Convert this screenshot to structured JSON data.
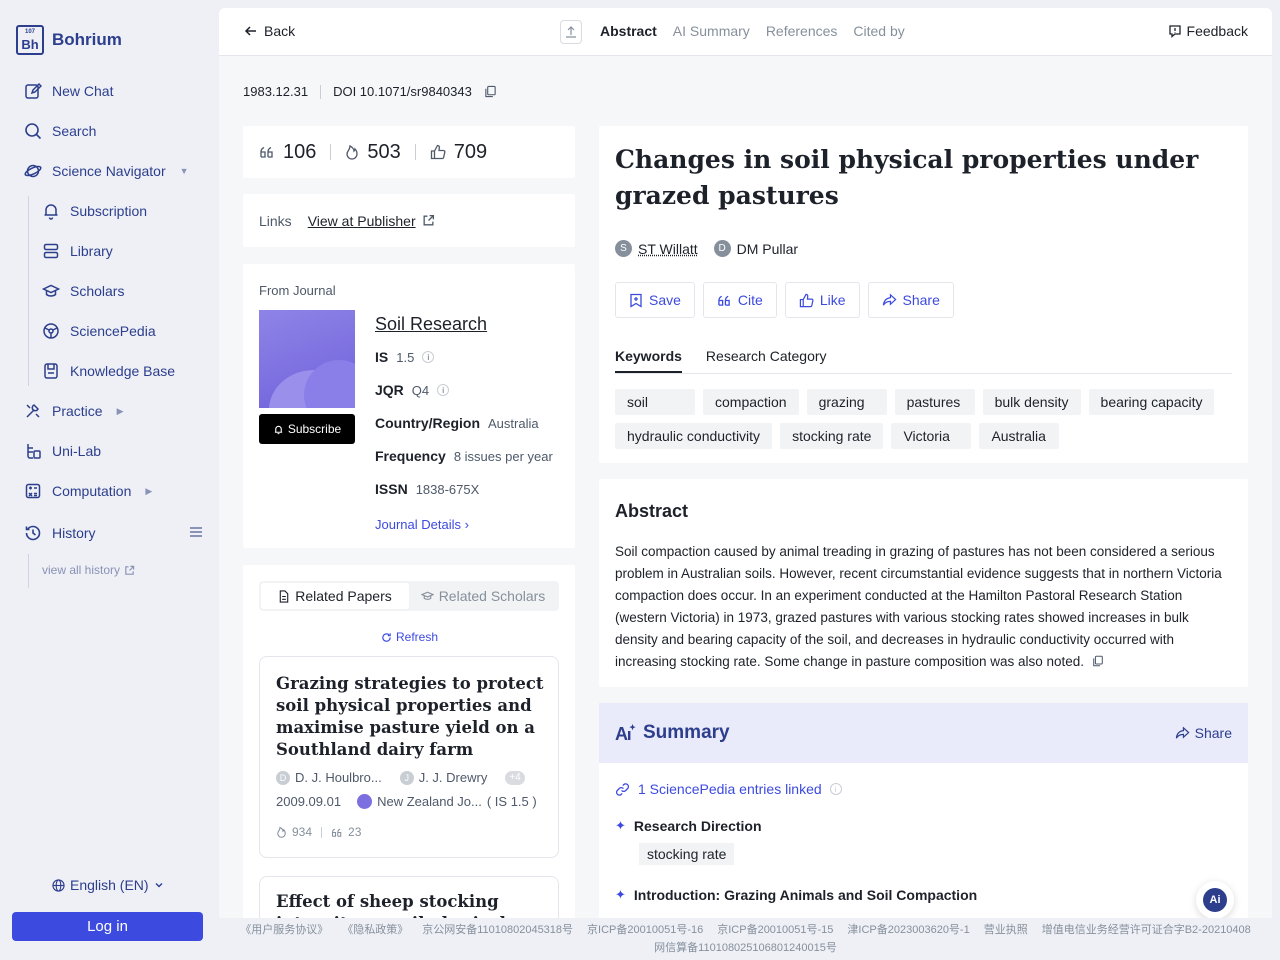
{
  "brand": {
    "name": "Bohrium",
    "logo_text": "Bh",
    "logo_small": "107"
  },
  "sidebar": {
    "items": [
      {
        "label": "New Chat"
      },
      {
        "label": "Search"
      },
      {
        "label": "Science Navigator"
      },
      {
        "label": "Subscription"
      },
      {
        "label": "Library"
      },
      {
        "label": "Scholars"
      },
      {
        "label": "SciencePedia"
      },
      {
        "label": "Knowledge Base"
      },
      {
        "label": "Practice"
      },
      {
        "label": "Uni-Lab"
      },
      {
        "label": "Computation"
      },
      {
        "label": "History"
      }
    ],
    "view_all_history": "view all history",
    "language": "English (EN)",
    "login": "Log in"
  },
  "topbar": {
    "back": "Back",
    "tabs": [
      "Abstract",
      "AI Summary",
      "References",
      "Cited by"
    ],
    "active_tab": "Abstract",
    "feedback": "Feedback"
  },
  "meta": {
    "date": "1983.12.31",
    "doi": "DOI 10.1071/sr9840343"
  },
  "stats": {
    "cites": "106",
    "hot": "503",
    "likes": "709"
  },
  "links": {
    "label": "Links",
    "publisher": "View at Publisher"
  },
  "journal": {
    "from": "From Journal",
    "name": "Soil Research",
    "subscribe": "Subscribe",
    "is_label": "IS",
    "is_value": "1.5",
    "jqr_label": "JQR",
    "jqr_value": "Q4",
    "country_label": "Country/Region",
    "country_value": "Australia",
    "freq_label": "Frequency",
    "freq_value": "8 issues per year",
    "issn_label": "ISSN",
    "issn_value": "1838-675X",
    "details": "Journal Details"
  },
  "related": {
    "tab_papers": "Related Papers",
    "tab_scholars": "Related Scholars",
    "refresh": "Refresh",
    "papers": [
      {
        "title": "Grazing strategies to protect soil physical properties and maximise pasture yield on a Southland dairy farm",
        "author1_initial": "D",
        "author1": "D. J. Houlbro...",
        "author2_initial": "J",
        "author2": "J. J. Drewry",
        "more": "+4",
        "date": "2009.09.01",
        "journal": "New Zealand Jo...",
        "is": "( IS 1.5 )",
        "hot": "934",
        "cites": "23"
      },
      {
        "title": "Effect of sheep stocking intensity on soil physical properties and"
      }
    ]
  },
  "paper": {
    "title": "Changes in soil physical properties under grazed pastures",
    "authors": [
      {
        "initial": "S",
        "name": "ST Willatt"
      },
      {
        "initial": "D",
        "name": "DM Pullar"
      }
    ],
    "actions": [
      "Save",
      "Cite",
      "Like",
      "Share"
    ],
    "kw_tabs": [
      "Keywords",
      "Research Category"
    ],
    "keywords": [
      "soil",
      "compaction",
      "grazing",
      "pastures",
      "bulk density",
      "bearing capacity",
      "hydraulic conductivity",
      "stocking rate",
      "Victoria",
      "Australia"
    ]
  },
  "abstract": {
    "heading": "Abstract",
    "text": "Soil compaction caused by animal treading in grazing of pastures has not been considered a serious problem in Australian soils. However, recent circumstantial evidence suggests that in northern Victoria compaction does occur. In an experiment conducted at the Hamilton Pastoral Research Station (western Victoria) in 1973, grazed pastures with various stocking rates showed increases in bulk density and bearing capacity of the soil, and decreases in hydraulic conductivity occurred with increasing stocking rate. Some change in pasture composition was also noted."
  },
  "summary": {
    "title": "Summary",
    "share": "Share",
    "sp_link": "1 SciencePedia entries linked",
    "research_direction": "Research Direction",
    "direction_tag": "stocking rate",
    "intro": "Introduction: Grazing Animals and Soil Compaction"
  },
  "footer": {
    "line1": [
      "《用户服务协议》",
      "《隐私政策》",
      "京公网安备11010802045318号",
      "京ICP备20010051号-16",
      "京ICP备20010051号-15",
      "津ICP备2023003620号-1",
      "营业执照",
      "增值电信业务经营许可证合字B2-20210408"
    ],
    "line2": "网信算备110108025106801240015号"
  },
  "colors": {
    "accent": "#3c4ae0",
    "brand": "#2c3e8c",
    "sidebar_bg": "#eef0f6"
  }
}
